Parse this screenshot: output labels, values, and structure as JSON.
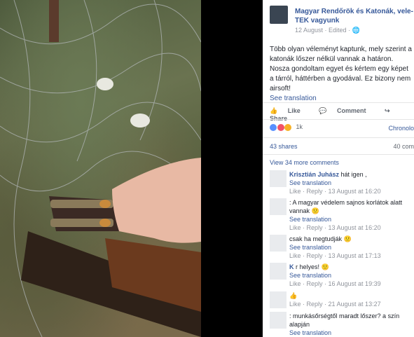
{
  "post": {
    "page_name": "Magyar Rendőrök és Katonák, vele-TEK vagyunk",
    "date": "12 August",
    "edited": "Edited",
    "text": "Több olyan véleményt kaptunk, mely szerint a katonák lőszer nélkül vannak a határon. Nosza gondoltam egyet és kértem egy képet a tárról, háttérben a gyodával. Ez bizony nem airsoft!",
    "see_translation": "See translation"
  },
  "actions": {
    "like": "Like",
    "comment": "Comment",
    "share": "Share"
  },
  "reactions": {
    "count": "1k",
    "sort": "Chronolo"
  },
  "stats": {
    "shares": "43 shares",
    "views": "40 com"
  },
  "view_more": "View 34 more comments",
  "comments": [
    {
      "name": "Krisztián Juhász",
      "text": "hát igen ,",
      "see": "See translation",
      "meta": "Like · Reply · 13 August at 16:20"
    },
    {
      "name": "",
      "text": ": A magyar védelem sajnos korlátok alatt vannak 🙁",
      "see": "See translation",
      "meta": "Like · Reply · 13 August at 16:20"
    },
    {
      "name": "",
      "text": "csak ha megtudják 🙁",
      "see": "See translation",
      "meta": "Like · Reply · 13 August at 17:13"
    },
    {
      "name": "K",
      "text": "r helyes! 🙂",
      "see": "See translation",
      "meta": "Like · Reply · 16 August at 19:39"
    },
    {
      "name": "",
      "text": "👍",
      "see": "",
      "meta": "Like · Reply · 21 August at 13:27"
    },
    {
      "name": "",
      "text": ": munkásőrségtől maradt lőszer? a szín alapján",
      "see": "See translation",
      "meta": ""
    }
  ],
  "colors": {
    "link": "#365899",
    "meta": "#90949c"
  }
}
